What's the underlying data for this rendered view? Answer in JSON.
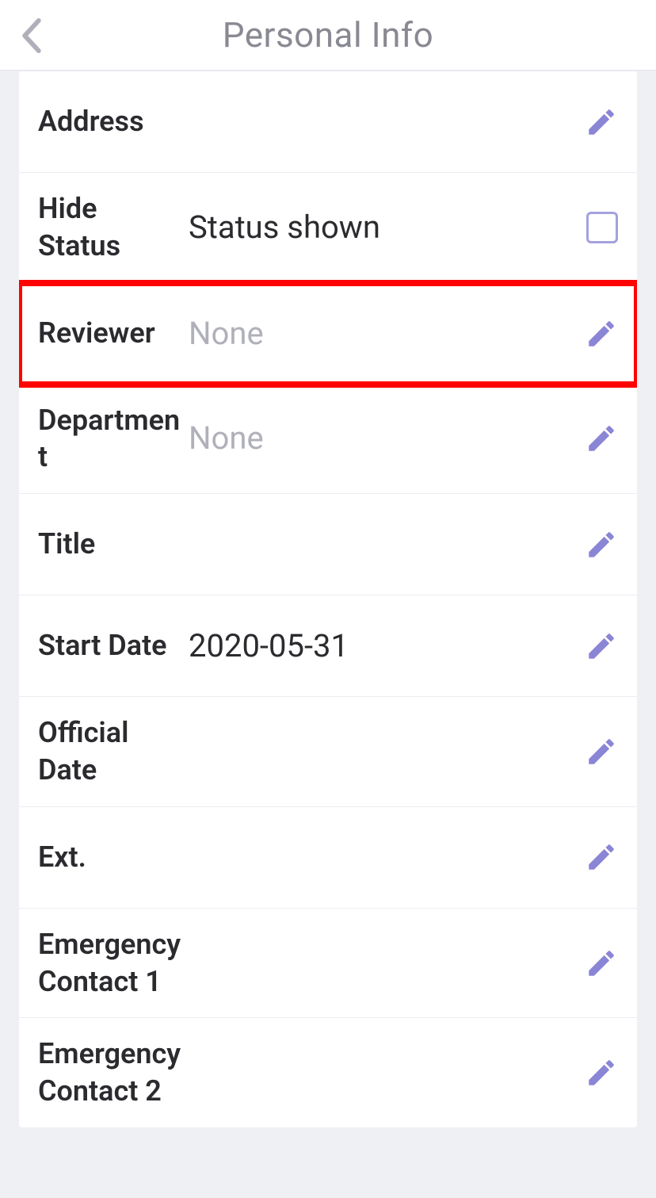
{
  "header": {
    "title": "Personal Info"
  },
  "rows": {
    "address": {
      "label": "Address",
      "value": ""
    },
    "hideStatus": {
      "label": "Hide Status",
      "value": "Status shown"
    },
    "reviewer": {
      "label": "Reviewer",
      "value": "None"
    },
    "department": {
      "label": "Department",
      "value": "None"
    },
    "title": {
      "label": "Title",
      "value": ""
    },
    "startDate": {
      "label": "Start Date",
      "value": "2020-05-31"
    },
    "officialDate": {
      "label": "Official Date",
      "value": ""
    },
    "ext": {
      "label": "Ext.",
      "value": ""
    },
    "ec1": {
      "label": "Emergency Contact 1",
      "value": ""
    },
    "ec2": {
      "label": "Emergency Contact 2",
      "value": ""
    }
  },
  "colors": {
    "accent": "#8b85d6",
    "highlight": "#ff0202"
  }
}
